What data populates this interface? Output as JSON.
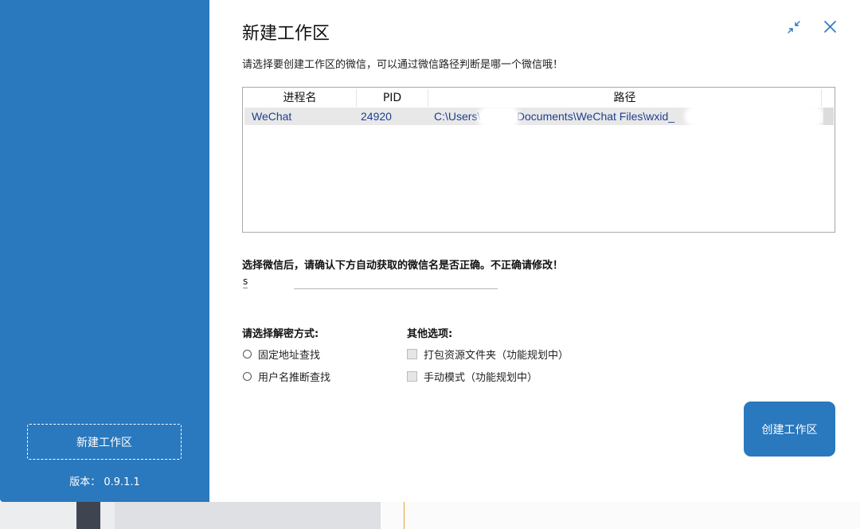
{
  "title": "新建工作区",
  "subtitle": "请选择要创建工作区的微信，可以通过微信路径判断是哪一个微信哦！",
  "window_controls": {
    "minimize_icon": "collapse-arrows-icon",
    "close_icon": "close-icon"
  },
  "table": {
    "columns": [
      "进程名",
      "PID",
      "路径"
    ],
    "rows": [
      {
        "process": "WeChat",
        "pid": "24920",
        "path_start": "C:\\Users\\",
        "path_mid": "\\Documents\\WeChat Files\\wxid_"
      }
    ]
  },
  "warning": "选择微信后，请确认下方自动获取的微信名是否正确。不正确请修改！",
  "wechat_name": {
    "label": "s",
    "value": ""
  },
  "decrypt": {
    "title": "请选择解密方式:",
    "options": [
      "固定地址查找",
      "用户名推断查找"
    ]
  },
  "other": {
    "title": "其他选项:",
    "options": [
      "打包资源文件夹（功能规划中）",
      "手动模式（功能规划中）"
    ]
  },
  "create_button": "创建工作区",
  "sidebar": {
    "new_workspace": "新建工作区",
    "version": "版本：  0.9.1.1"
  },
  "colors": {
    "accent": "#2a78bd",
    "row_text": "#1d3f8f"
  }
}
